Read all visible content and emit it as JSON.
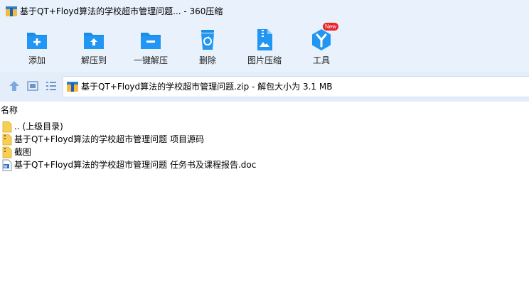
{
  "window": {
    "title": "基于QT+Floyd算法的学校超市管理问题... - 360压缩"
  },
  "toolbar": {
    "items": [
      {
        "label": "添加",
        "icon": "add-icon"
      },
      {
        "label": "解压到",
        "icon": "extract-to-icon"
      },
      {
        "label": "一键解压",
        "icon": "one-click-extract-icon"
      },
      {
        "label": "删除",
        "icon": "delete-icon"
      },
      {
        "label": "图片压缩",
        "icon": "image-compress-icon"
      },
      {
        "label": "工具",
        "icon": "tools-icon",
        "badge": "New"
      }
    ]
  },
  "nav": {
    "buttons": [
      "up-icon",
      "view-icon",
      "list-view-icon"
    ]
  },
  "address": {
    "text": "基于QT+Floyd算法的学校超市管理问题.zip - 解包大小为 3.1 MB"
  },
  "list": {
    "column_name": "名称",
    "rows": [
      {
        "name": ".. (上级目录)",
        "type": "folder"
      },
      {
        "name": "基于QT+Floyd算法的学校超市管理问题 项目源码",
        "type": "folder-zip"
      },
      {
        "name": "截图",
        "type": "folder-zip"
      },
      {
        "name": "基于QT+Floyd算法的学校超市管理问题 任务书及课程报告.doc",
        "type": "doc"
      }
    ]
  },
  "colors": {
    "header_bg": "#e9f2fc",
    "icon_blue": "#1a8de6",
    "badge_red": "#e8242a"
  }
}
